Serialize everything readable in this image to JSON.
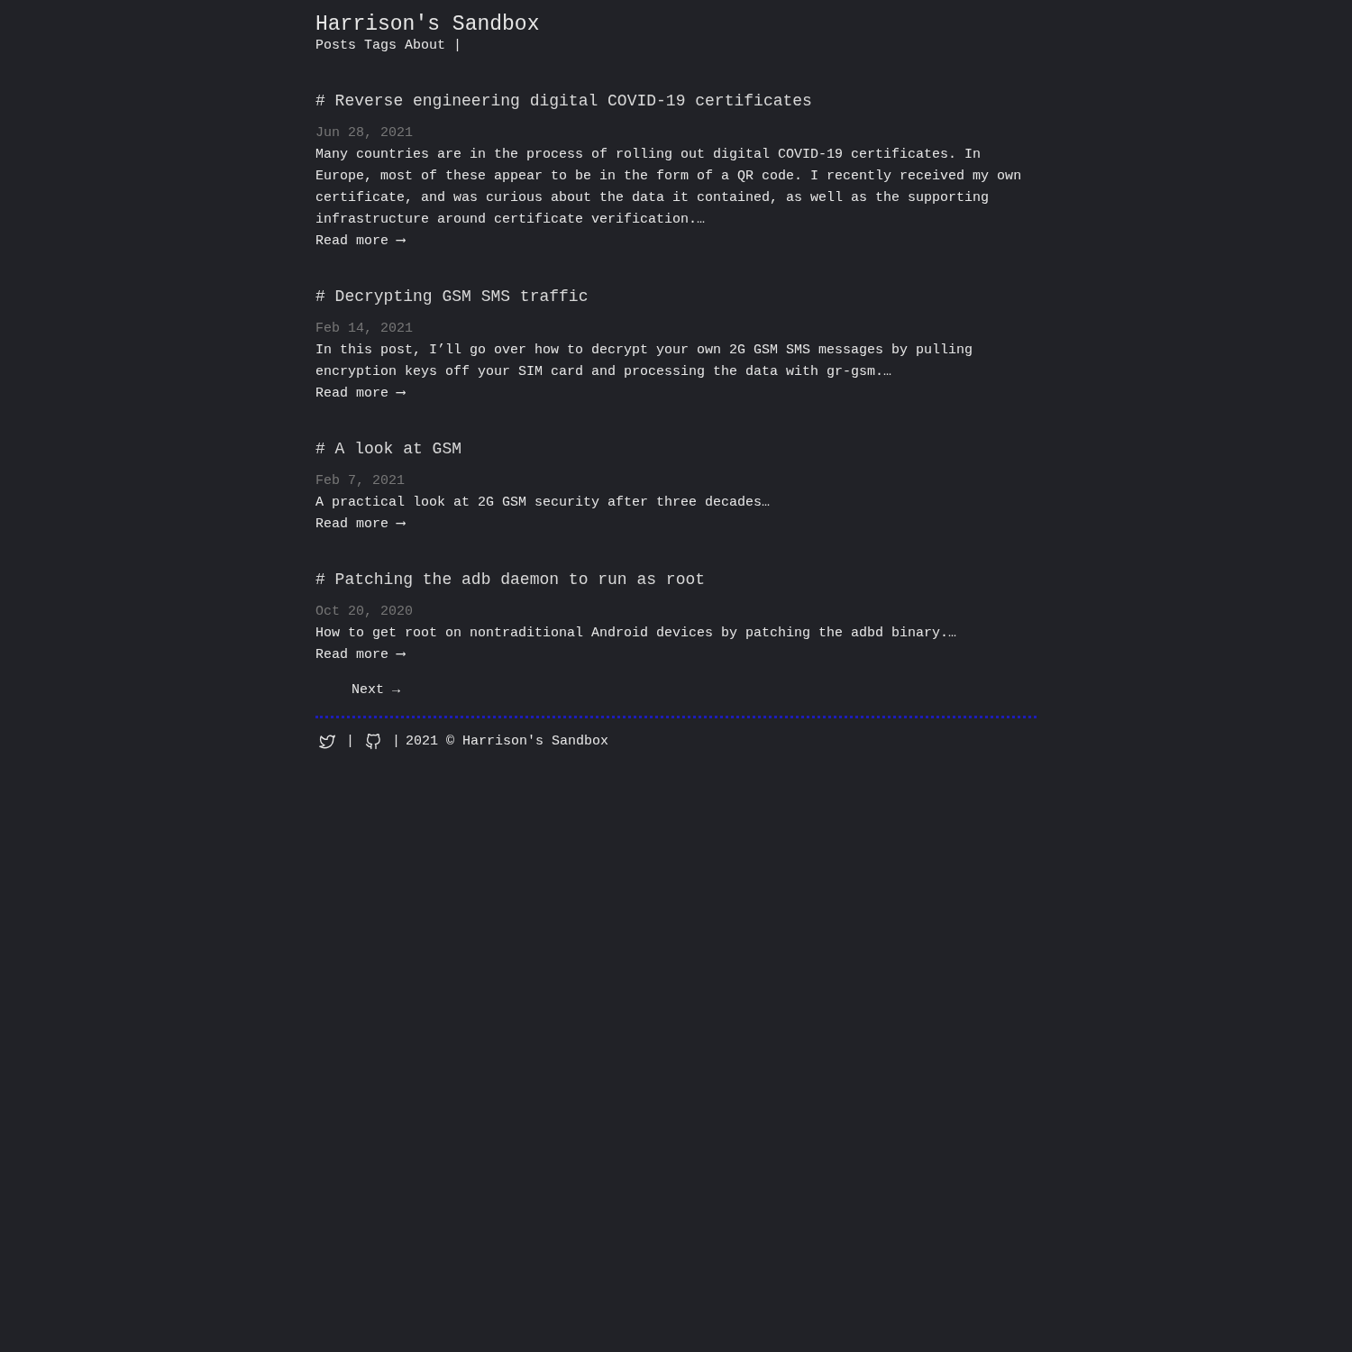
{
  "site": {
    "title": "Harrison's Sandbox",
    "nav": [
      "Posts",
      "Tags",
      "About"
    ],
    "nav_separator": "|"
  },
  "posts": [
    {
      "title": "# Reverse engineering digital COVID-19 certificates",
      "date": "Jun 28, 2021",
      "summary": "Many countries are in the process of rolling out digital COVID-19 certificates. In Europe, most of these appear to be in the form of a QR code. I recently received my own certificate, and was curious about the data it contained, as well as the supporting infrastructure around certificate verification.…",
      "read_more": "Read more ⟶"
    },
    {
      "title": "# Decrypting GSM SMS traffic",
      "date": "Feb 14, 2021",
      "summary": "In this post, I’ll go over how to decrypt your own 2G GSM SMS messages by pulling encryption keys off your SIM card and processing the data with gr-gsm.…",
      "read_more": "Read more ⟶"
    },
    {
      "title": "# A look at GSM",
      "date": "Feb 7, 2021",
      "summary": "A practical look at 2G GSM security after three decades…",
      "read_more": "Read more ⟶"
    },
    {
      "title": "# Patching the adb daemon to run as root",
      "date": "Oct 20, 2020",
      "summary": "How to get root on nontraditional Android devices by patching the adbd binary.…",
      "read_more": "Read more ⟶"
    }
  ],
  "pagination": {
    "next": "Next →"
  },
  "footer": {
    "separators": [
      "|",
      "|"
    ],
    "copyright": "2021 © Harrison's Sandbox"
  }
}
